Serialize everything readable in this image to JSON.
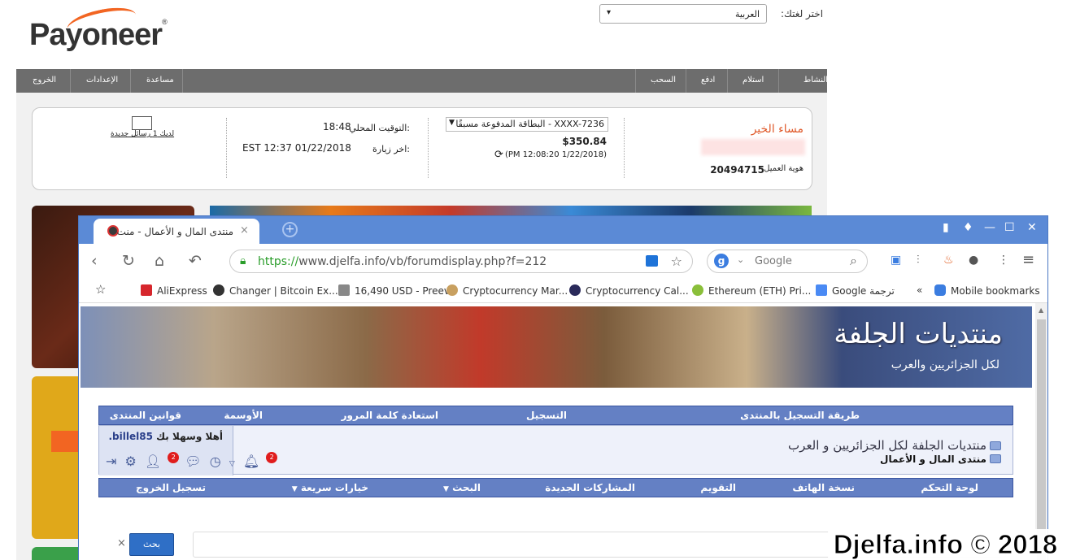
{
  "payoneer": {
    "logo": "Payoneer",
    "lang_label": "اختر لغتك:",
    "lang_value": "العربية",
    "nav": {
      "activity": "النشاط",
      "receive": "استلام",
      "pay": "ادفع",
      "withdraw": "السحب",
      "help": "مساعدة",
      "settings": "الإعدادات",
      "logout": "الخروج"
    },
    "greeting": "مساء الخير",
    "customer_id_label": "هوية العميل",
    "customer_id": "20494715",
    "card_label": "البطاقة المدفوعة مسبقًا - XXXX-7236",
    "balance": "$350.84",
    "balance_time": "(PM 12:08:20 1/22/2018)",
    "local_time_label": "التوقيت المحلي:",
    "local_time": "18:48",
    "last_visit_label": "اخر زيارة:",
    "last_visit": "EST 12:37 01/22/2018",
    "messages_text": "لديك 1 رسائل جديدة"
  },
  "browser": {
    "tab_title": "منتدى المال و الأعمال - منت",
    "url_proto": "https://",
    "url_rest": "www.djelfa.info/vb/forumdisplay.php?f=212",
    "search_placeholder": "Google",
    "bookmarks": [
      "AliExpress",
      "Changer | Bitcoin Ex...",
      "16,490 USD - Preev",
      "Cryptocurrency Mar...",
      "Cryptocurrency Cal...",
      "Ethereum (ETH) Pri...",
      "Google ترجمة",
      "Mobile bookmarks"
    ],
    "more_bookmarks": "«"
  },
  "forum": {
    "banner_title": "منتديات الجلفة",
    "banner_sub": "لكل الجزائريين والعرب",
    "top_nav": {
      "register_method": "طريقة التسجيل بالمنتدى",
      "register": "التسجيل",
      "recover": "استعادة كلمة المرور",
      "medals": "الأوسمة",
      "rules": "قوانين المنتدى"
    },
    "welcome_prefix": "أهلا وسهلا بك",
    "username": "billel85.",
    "crumb_root": "منتديات الجلفة لكل الجزائريين و العرب",
    "crumb_current": "منتدى المال و الأعمال",
    "notif_count": "2",
    "friend_count": "2",
    "bottom_nav": {
      "control": "لوحة التحكم",
      "mobile": "نسخة الهاتف",
      "calendar": "التقويم",
      "new_posts": "المشاركات الجديدة",
      "search": "البحث",
      "quick": "خيارات سريعة",
      "logout": "تسجيل الخروج"
    },
    "search_button": "بحث",
    "clear": "×"
  },
  "watermark": "Djelfa.info © 2018",
  "colors": {
    "payoneer_orange": "#f26522",
    "forum_nav": "#6480c4",
    "browser_frame": "#5b8ad6"
  }
}
